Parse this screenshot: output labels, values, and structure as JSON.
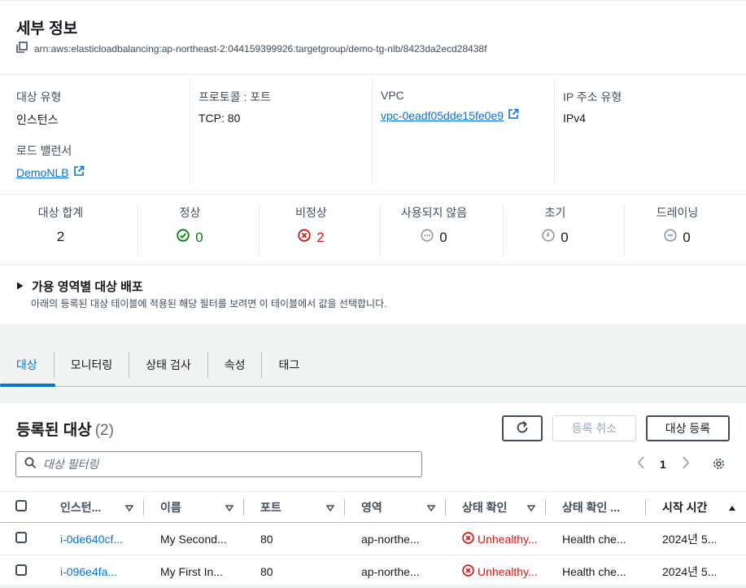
{
  "details": {
    "title": "세부 정보",
    "arn": "arn:aws:elasticloadbalancing:ap-northeast-2:044159399926:targetgroup/demo-tg-nlb/8423da2ecd28438f",
    "target_type_label": "대상 유형",
    "target_type_value": "인스턴스",
    "protocol_label": "프로토콜 : 포트",
    "protocol_value": "TCP: 80",
    "vpc_label": "VPC",
    "vpc_value": "vpc-0eadf05dde15fe0e9",
    "ip_type_label": "IP 주소 유형",
    "ip_type_value": "IPv4",
    "lb_label": "로드 밸런서",
    "lb_value": "DemoNLB"
  },
  "stats": {
    "total_label": "대상 합계",
    "total_value": "2",
    "healthy_label": "정상",
    "healthy_value": "0",
    "unhealthy_label": "비정상",
    "unhealthy_value": "2",
    "unused_label": "사용되지 않음",
    "unused_value": "0",
    "initial_label": "초기",
    "initial_value": "0",
    "draining_label": "드레이닝",
    "draining_value": "0"
  },
  "az": {
    "title": "가용 영역별 대상 배포",
    "description": "아래의 등록된 대상 테이블에 적용된 해당 필터를 보려면 이 테이블에서 값을 선택합니다."
  },
  "tabs": [
    "대상",
    "모니터링",
    "상태 검사",
    "속성",
    "태그"
  ],
  "targets": {
    "title": "등록된 대상",
    "count": "(2)",
    "deregister_label": "등록 취소",
    "register_label": "대상 등록",
    "search_placeholder": "대상 필터링",
    "page": "1",
    "columns": [
      "인스턴...",
      "이름",
      "포트",
      "영역",
      "상태 확인",
      "상태 확인 ...",
      "시작 시간"
    ],
    "rows": [
      {
        "instance": "i-0de640cf...",
        "name": "My Second...",
        "port": "80",
        "zone": "ap-northe...",
        "health": "Unhealthy...",
        "details": "Health che...",
        "launch": "2024년 5..."
      },
      {
        "instance": "i-096e4fa...",
        "name": "My First In...",
        "port": "80",
        "zone": "ap-northe...",
        "health": "Unhealthy...",
        "details": "Health che...",
        "launch": "2024년 5..."
      }
    ]
  },
  "colors": {
    "link": "#0972d3",
    "success": "#037f0c",
    "error": "#d91515"
  }
}
